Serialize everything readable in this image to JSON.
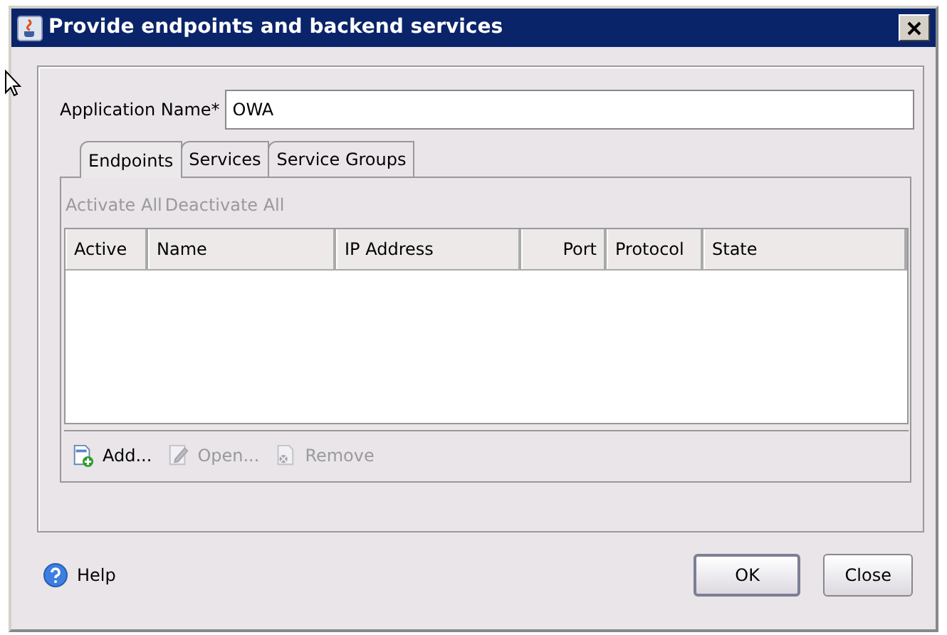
{
  "window": {
    "title": "Provide endpoints and backend services"
  },
  "application_name": {
    "label": "Application Name*",
    "value": "OWA"
  },
  "tabs": [
    {
      "label": "Endpoints",
      "selected": true
    },
    {
      "label": "Services",
      "selected": false
    },
    {
      "label": "Service Groups",
      "selected": false
    }
  ],
  "actions": [
    {
      "label": "Activate All",
      "disabled": true
    },
    {
      "label": "Deactivate All",
      "disabled": true
    }
  ],
  "table": {
    "columns": [
      {
        "label": "Active",
        "right_aligned": false
      },
      {
        "label": "Name",
        "right_aligned": false
      },
      {
        "label": "IP Address",
        "right_aligned": false
      },
      {
        "label": "Port",
        "right_aligned": true
      },
      {
        "label": "Protocol",
        "right_aligned": false
      },
      {
        "label": "State",
        "right_aligned": false
      }
    ]
  },
  "toolbar": [
    {
      "kind": "add",
      "label": "Add...",
      "disabled": false
    },
    {
      "kind": "open",
      "label": "Open...",
      "disabled": true
    },
    {
      "kind": "remove",
      "label": "Remove",
      "disabled": true
    }
  ],
  "help": {
    "label": "Help"
  },
  "buttons": [
    {
      "label": "OK",
      "default": true
    },
    {
      "label": "Close",
      "default": false
    }
  ]
}
